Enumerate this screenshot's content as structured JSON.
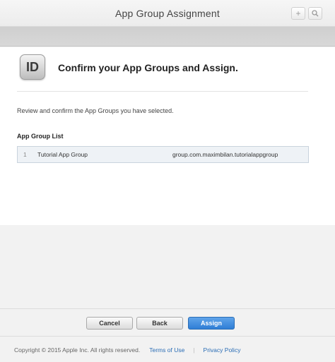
{
  "window": {
    "title": "App Group Assignment",
    "add_button_label": "+",
    "search_icon": "search-icon"
  },
  "panel": {
    "badge_text": "ID",
    "heading": "Confirm your App Groups and Assign.",
    "instructions": "Review and confirm the App Groups you have selected.",
    "list_label": "App Group List",
    "groups": [
      {
        "number": "1",
        "name": "Tutorial App Group",
        "identifier": "group.com.maximbilan.tutorialappgroup"
      }
    ]
  },
  "actions": {
    "cancel_label": "Cancel",
    "back_label": "Back",
    "assign_label": "Assign"
  },
  "footer": {
    "copyright": "Copyright © 2015 Apple Inc. All rights reserved.",
    "terms_label": "Terms of Use",
    "separator": "|",
    "privacy_label": "Privacy Policy"
  },
  "colors": {
    "accent": "#2f7ed6",
    "link": "#2a6db5"
  }
}
